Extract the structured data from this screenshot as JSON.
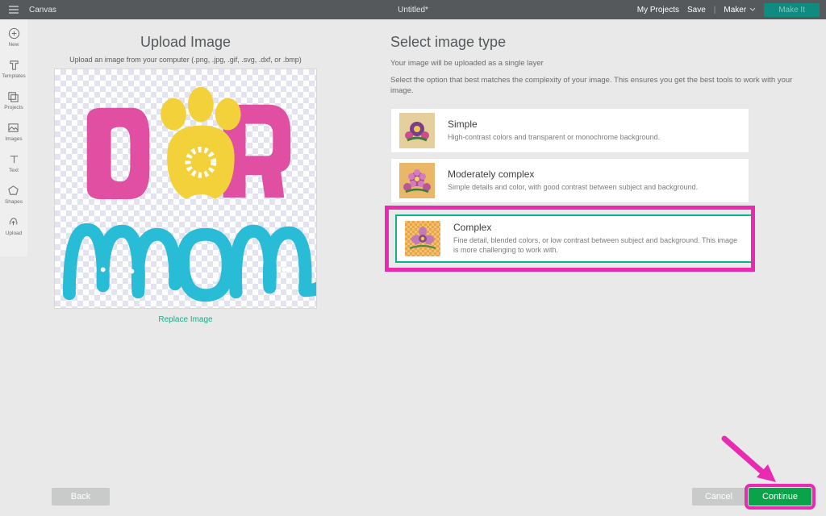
{
  "topbar": {
    "brand": "Canvas",
    "title": "Untitled*",
    "my_projects": "My Projects",
    "save": "Save",
    "machine": "Maker",
    "make_button": "Make It"
  },
  "rail": {
    "items": [
      {
        "label": "New"
      },
      {
        "label": "Templates"
      },
      {
        "label": "Projects"
      },
      {
        "label": "Images"
      },
      {
        "label": "Text"
      },
      {
        "label": "Shapes"
      },
      {
        "label": "Upload"
      }
    ]
  },
  "upload_panel": {
    "title": "Upload Image",
    "hint": "Upload an image from your computer (.png, .jpg, .gif, .svg, .dxf, or .bmp)",
    "replace_link": "Replace Image",
    "artwork": {
      "top_word": "DOG",
      "bottom_word": "mom"
    }
  },
  "type_panel": {
    "title": "Select image type",
    "line1": "Your image will be uploaded as a single layer",
    "line2": "Select the option that best matches the complexity of your image. This ensures you get the best tools to work with your image.",
    "options": [
      {
        "title": "Simple",
        "desc": "High-contrast colors and transparent or monochrome background."
      },
      {
        "title": "Moderately complex",
        "desc": "Simple details and color, with good contrast between subject and background."
      },
      {
        "title": "Complex",
        "desc": "Fine detail, blended colors, or low contrast between subject and background. This image is more challenging to work with."
      }
    ],
    "selected_index": 2
  },
  "buttons": {
    "back": "Back",
    "cancel": "Cancel",
    "continue": "Continue"
  },
  "colors": {
    "accent_emphasis": "#e92bb1",
    "accent_green": "#0aa34a",
    "accent_teal": "#0fb18a",
    "art_pink": "#e14fa2",
    "art_yellow": "#f3d13b",
    "art_cyan": "#28bcd6"
  }
}
